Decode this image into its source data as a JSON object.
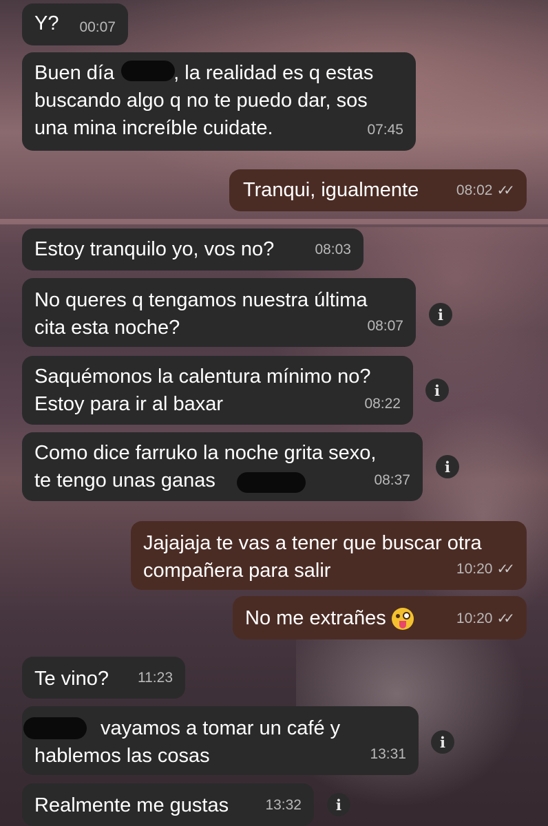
{
  "messages": [
    {
      "side": "in",
      "text": "Y?",
      "time": "00:07"
    },
    {
      "side": "in",
      "line1_pre": "Buen día ",
      "line1_post": ", la realidad es q estas",
      "rest": "buscando algo q no te puedo dar, sos\nuna mina increíble cuidate.",
      "time": "07:45"
    },
    {
      "side": "out",
      "text": "Tranqui, igualmente",
      "time": "08:02"
    },
    {
      "side": "in",
      "text": "Estoy tranquilo yo, vos no?",
      "time": "08:03"
    },
    {
      "side": "in",
      "text": "No queres q tengamos nuestra última\ncita esta noche?",
      "time": "08:07"
    },
    {
      "side": "in",
      "text": "Saquémonos la calentura mínimo no?\nEstoy para ir al baxar",
      "time": "08:22"
    },
    {
      "side": "in",
      "line1": "Como dice farruko la noche grita sexo,",
      "line2_pre": "te tengo unas ganas",
      "time": "08:37"
    },
    {
      "side": "out",
      "text": "Jajajaja te vas a tener que buscar otra\ncompañera para salir",
      "time": "10:20"
    },
    {
      "side": "out",
      "text": "No me extrañes",
      "emoji": "winking-face-with-tongue",
      "time": "10:20"
    },
    {
      "side": "in",
      "text": "Te vino?",
      "time": "11:23"
    },
    {
      "side": "in",
      "line1_post": "vayamos a tomar un café y",
      "rest": "hablemos las cosas",
      "time": "13:31"
    },
    {
      "side": "in",
      "text": "Realmente me gustas",
      "time": "13:32"
    }
  ],
  "info_glyph": "i",
  "read_receipt": "✓✓",
  "colors": {
    "incoming": "#2a2a2b",
    "outgoing": "#4b2c24",
    "time": "#b9b9b9"
  }
}
